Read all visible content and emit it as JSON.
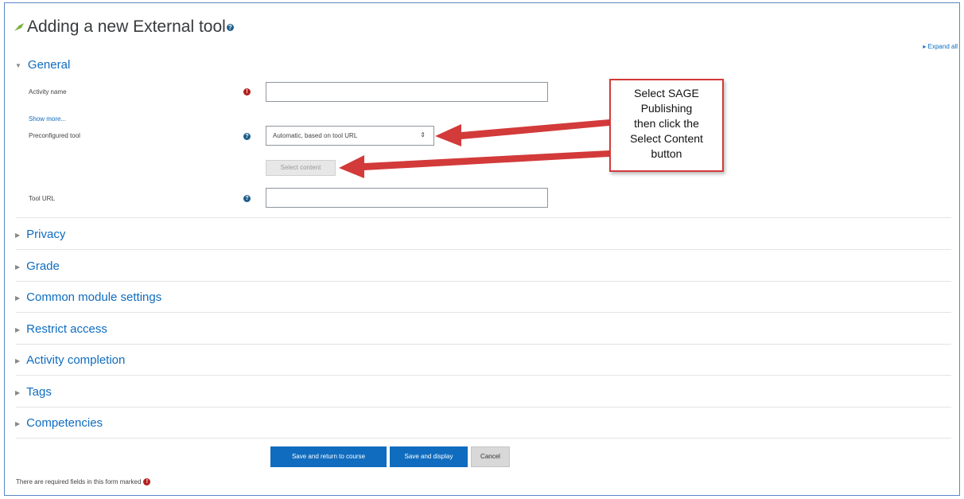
{
  "page": {
    "title": "Adding a new External tool",
    "expand_all": "Expand all"
  },
  "general": {
    "heading": "General",
    "activity_name_label": "Activity name",
    "show_more": "Show more...",
    "preconfigured_label": "Preconfigured tool",
    "preconfigured_value": "Automatic, based on tool URL",
    "select_content_label": "Select content",
    "tool_url_label": "Tool URL"
  },
  "sections": [
    {
      "label": "Privacy"
    },
    {
      "label": "Grade"
    },
    {
      "label": "Common module settings"
    },
    {
      "label": "Restrict access"
    },
    {
      "label": "Activity completion"
    },
    {
      "label": "Tags"
    },
    {
      "label": "Competencies"
    }
  ],
  "buttons": {
    "save_return": "Save and return to course",
    "save_display": "Save and display",
    "cancel": "Cancel"
  },
  "footer": {
    "required_note": "There are required fields in this form marked"
  },
  "callout": {
    "lines": [
      "Select SAGE",
      "Publishing",
      "then click the",
      "Select Content",
      "button"
    ]
  },
  "colors": {
    "link_blue": "#0f6cbf",
    "required_red": "#b31e1e",
    "callout_red": "#d33a3a"
  },
  "icons": {
    "required": "exclamation-circle-icon",
    "help": "question-circle-icon",
    "collapse": "triangle-right-icon",
    "expand": "triangle-down-icon"
  }
}
